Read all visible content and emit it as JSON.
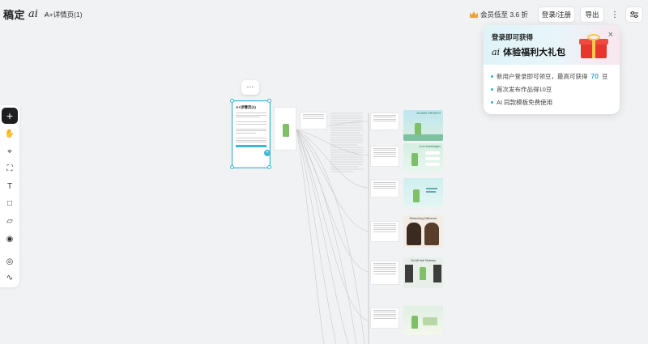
{
  "app": {
    "logo_text": "稿定",
    "logo_swirl": "ai",
    "doc_title": "A+详情页(1)"
  },
  "header": {
    "vip_text": "会员低至 3.6 折",
    "login_label": "登录/注册",
    "export_label": "导出",
    "more_label": "⋮"
  },
  "tools": [
    {
      "name": "add",
      "glyph": "+"
    },
    {
      "name": "hand",
      "glyph": "✋"
    },
    {
      "name": "pin",
      "glyph": "⌖"
    },
    {
      "name": "crop",
      "glyph": "⛶"
    },
    {
      "name": "text",
      "glyph": "T"
    },
    {
      "name": "rect",
      "glyph": "□"
    },
    {
      "name": "sticky",
      "glyph": "▱"
    },
    {
      "name": "user",
      "glyph": "◉"
    },
    {
      "name": "target",
      "glyph": "◎"
    },
    {
      "name": "path",
      "glyph": "∿"
    }
  ],
  "popup": {
    "line1": "登录即可获得",
    "line2_sig": "ai",
    "line2": "体验福利大礼包",
    "item1_pre": "新用户登录即可领豆，最高可获得",
    "item1_num": "70",
    "item1_post": "豆",
    "item2": "首次发布作品得10豆",
    "item3": "AI 同款模板免费使用",
    "close": "×"
  },
  "canvas": {
    "selection_more": "···",
    "node_title": "A+详情页(1)",
    "card_labels": [
      "ISLAND GROWTH",
      "Core Advantages",
      "Refreshing Difference",
      "On All Hair Textures"
    ]
  },
  "colors": {
    "accent": "#3fb6d6",
    "highlight": "#2bb3c9",
    "gift": "#e8352f"
  }
}
